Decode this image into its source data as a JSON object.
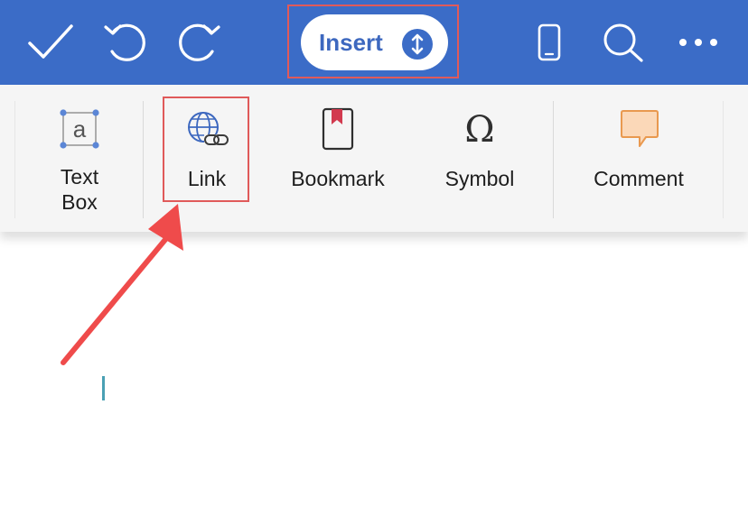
{
  "toolbar": {
    "mode_label": "Insert",
    "accent": "#3b6cc7",
    "icons": [
      "checkmark-icon",
      "undo-icon",
      "redo-icon",
      "mode-toggle-icon",
      "phone-icon",
      "search-icon",
      "more-icon"
    ]
  },
  "ribbon": {
    "items": [
      {
        "label_line1": "Text",
        "label_line2": "Box",
        "icon": "text-box-icon"
      },
      {
        "label": "Link",
        "icon": "link-icon"
      },
      {
        "label": "Bookmark",
        "icon": "bookmark-icon"
      },
      {
        "label": "Symbol",
        "icon": "omega-icon"
      },
      {
        "label": "Comment",
        "icon": "comment-icon"
      }
    ]
  },
  "annotation": {
    "highlight_color": "#e05a5a"
  }
}
